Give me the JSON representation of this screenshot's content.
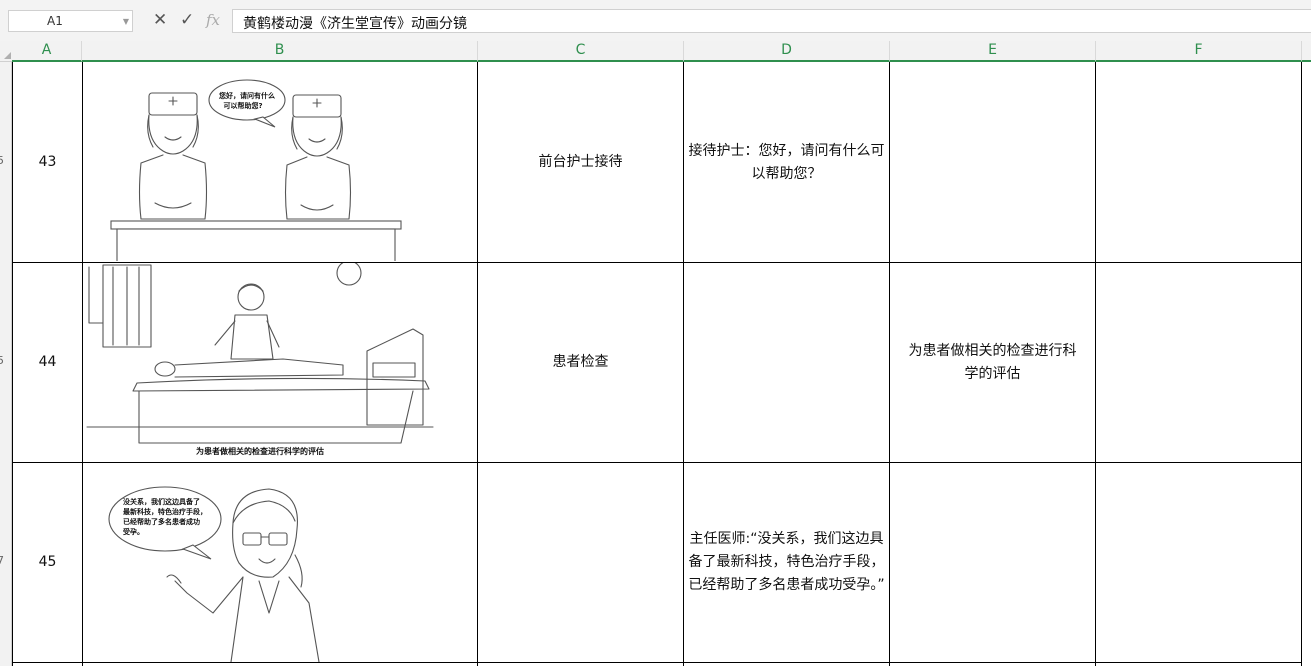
{
  "formula_bar": {
    "name_box": "A1",
    "cancel_icon": "close-icon",
    "confirm_icon": "check-icon",
    "fx_label": "fx",
    "content": "黄鹤楼动漫《济生堂宣传》动画分镜"
  },
  "columns": [
    "A",
    "B",
    "C",
    "D",
    "E",
    "F"
  ],
  "row_headers": [
    "5",
    "5",
    "7"
  ],
  "rows": [
    {
      "number": "43",
      "image": "nurses-at-reception",
      "bubble": [
        "您好，请问有什么",
        "可以帮助您?"
      ],
      "c": "前台护士接待",
      "d": "接待护士：您好，请问有什么可以帮助您？",
      "e": "",
      "f": ""
    },
    {
      "number": "44",
      "image": "doctor-examining-patient",
      "caption": "为患者做相关的检查进行科学的评估",
      "c": "患者检查",
      "d": "",
      "e": "为患者做相关的检查进行科学的评估",
      "f": ""
    },
    {
      "number": "45",
      "image": "chief-doctor-speaking",
      "bubble": [
        "没关系，我们这边具备了",
        "最新科技，特色治疗手段，",
        "已经帮助了多名患者成功",
        "受孕。"
      ],
      "c": "",
      "d": "主任医师:“没关系，我们这边具备了最新科技，特色治疗手段，已经帮助了多名患者成功受孕。”",
      "e": "",
      "f": ""
    }
  ]
}
